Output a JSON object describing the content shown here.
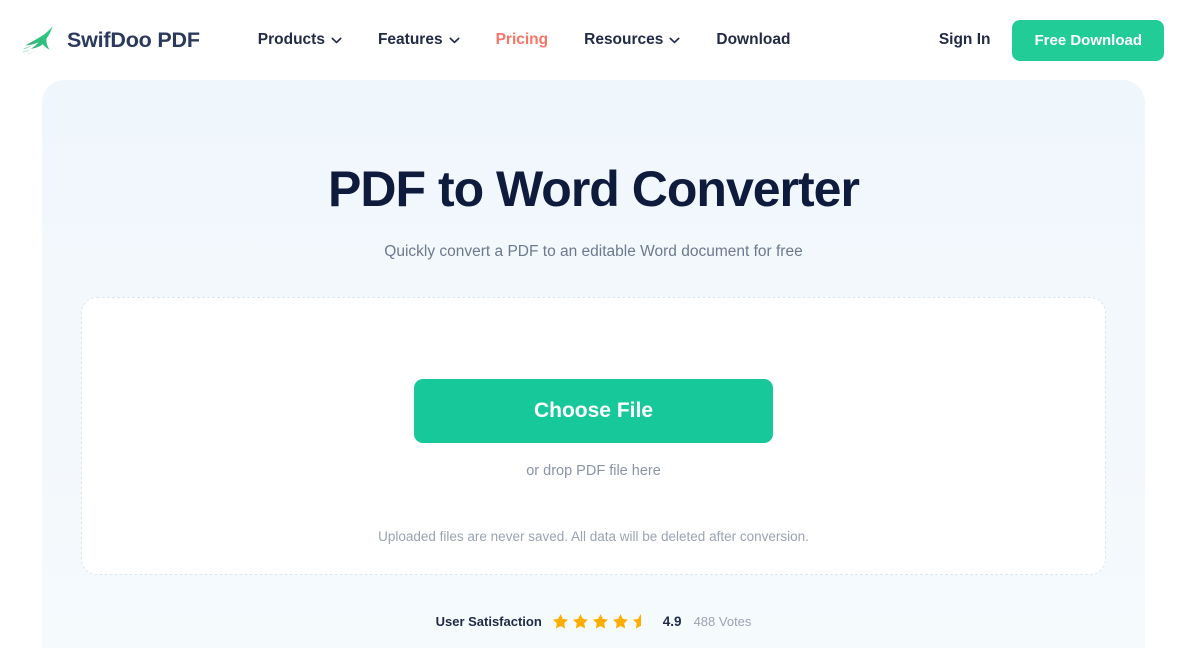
{
  "brand": {
    "name": "SwifDoo PDF",
    "logo_icon": "swallow-bird-icon"
  },
  "nav": {
    "items": [
      {
        "label": "Products",
        "has_caret": true,
        "active": false
      },
      {
        "label": "Features",
        "has_caret": true,
        "active": false
      },
      {
        "label": "Pricing",
        "has_caret": false,
        "active": true
      },
      {
        "label": "Resources",
        "has_caret": true,
        "active": false
      },
      {
        "label": "Download",
        "has_caret": false,
        "active": false
      }
    ],
    "caret_icon": "chevron-down-icon"
  },
  "account": {
    "sign_in_label": "Sign In",
    "free_download_label": "Free Download"
  },
  "hero": {
    "title": "PDF to Word Converter",
    "subtitle": "Quickly convert a PDF to an editable Word document for free"
  },
  "upload": {
    "choose_file_label": "Choose File",
    "drop_hint": "or drop PDF file here",
    "privacy_note": "Uploaded files are never saved. All data will be deleted after conversion."
  },
  "rating": {
    "label": "User Satisfaction",
    "score": "4.9",
    "votes": "488 Votes",
    "stars_filled": 4,
    "star_partial": 0.55,
    "star_icon": "star-icon"
  },
  "colors": {
    "brand_navy": "#2b3a5c",
    "accent_green": "#17c89b",
    "button_green": "#22cc96",
    "active_nav_coral": "#fb7466",
    "hero_bg": "#f0f7fc",
    "star_gold": "#ffae00",
    "heading_navy": "#0f1b3d"
  }
}
